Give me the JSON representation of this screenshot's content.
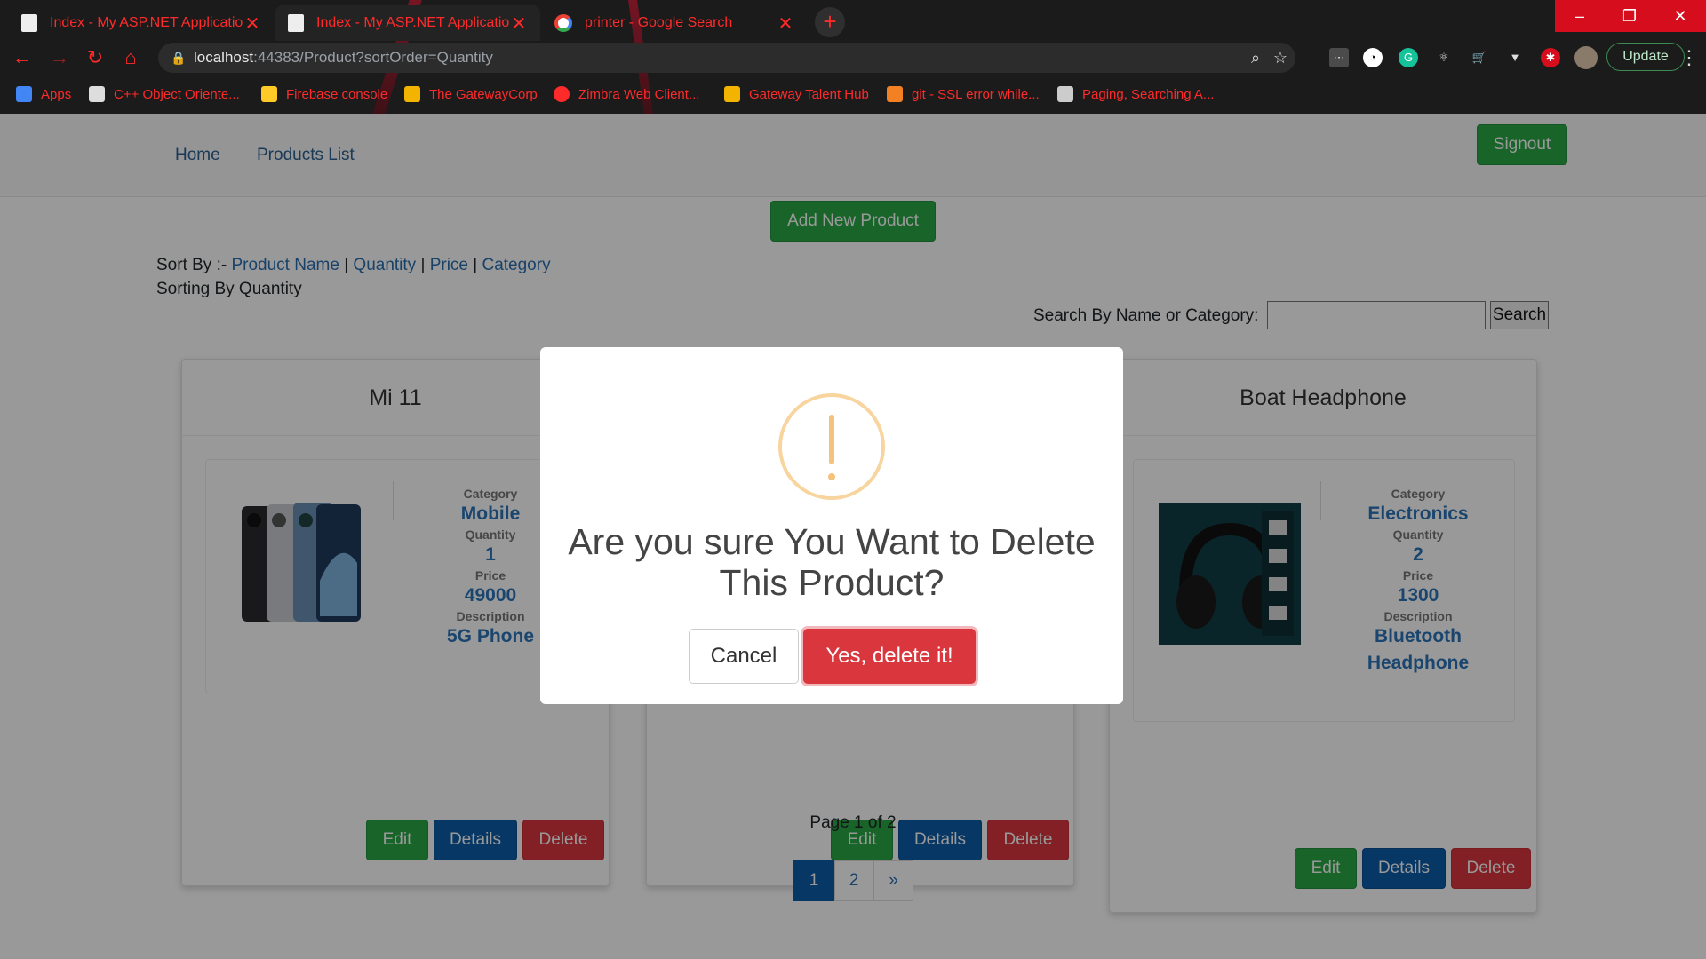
{
  "browser": {
    "tabs": [
      {
        "title": "Index - My ASP.NET Application",
        "close": "✕"
      },
      {
        "title": "Index - My ASP.NET Application",
        "close": "✕"
      },
      {
        "title": "printer - Google Search",
        "close": "✕"
      }
    ],
    "new_tab": "+",
    "window_controls": [
      "–",
      "❐",
      "✕"
    ],
    "url_host": "localhost",
    "url_path": ":44383/Product?sortOrder=Quantity",
    "update_label": "Update",
    "bookmarks": [
      "Apps",
      "C++ Object Oriente...",
      "Firebase console",
      "The GatewayCorp",
      "Zimbra Web Client...",
      "Gateway Talent Hub",
      "git - SSL error while...",
      "Paging, Searching A..."
    ]
  },
  "nav": {
    "home": "Home",
    "products_list": "Products List",
    "signout": "Signout"
  },
  "page": {
    "add_new_product": "Add New Product",
    "sort_by_label": "Sort By :-",
    "sort_options": [
      "Product Name",
      "Quantity",
      "Price",
      "Category"
    ],
    "sort_sep": "|",
    "sorting_status": "Sorting By Quantity",
    "search_label": "Search By Name or Category:",
    "search_value": "",
    "search_button": "Search"
  },
  "labels": {
    "category": "Category",
    "quantity": "Quantity",
    "price": "Price",
    "description": "Description",
    "edit": "Edit",
    "details": "Details",
    "delete": "Delete"
  },
  "products": [
    {
      "name": "Mi 11",
      "category": "Mobile",
      "quantity": "1",
      "price": "49000",
      "description": "5G Phone"
    },
    {
      "name": "Boat Headphone",
      "category": "Electronics",
      "quantity": "2",
      "price": "1300",
      "description_line1": "Bluetooth",
      "description_line2": "Headphone"
    }
  ],
  "pagination": {
    "status": "Page 1 of 2",
    "pages": [
      "1",
      "2"
    ],
    "next": "»",
    "current": 1
  },
  "dialog": {
    "message": "Are you sure You Want to Delete This Product?",
    "cancel": "Cancel",
    "confirm": "Yes, delete it!"
  },
  "colors": {
    "primary": "#0d5ca8",
    "success": "#28a745",
    "danger": "#d9363e",
    "warning_icon": "#f8d49e",
    "link": "#2a6fb0"
  }
}
